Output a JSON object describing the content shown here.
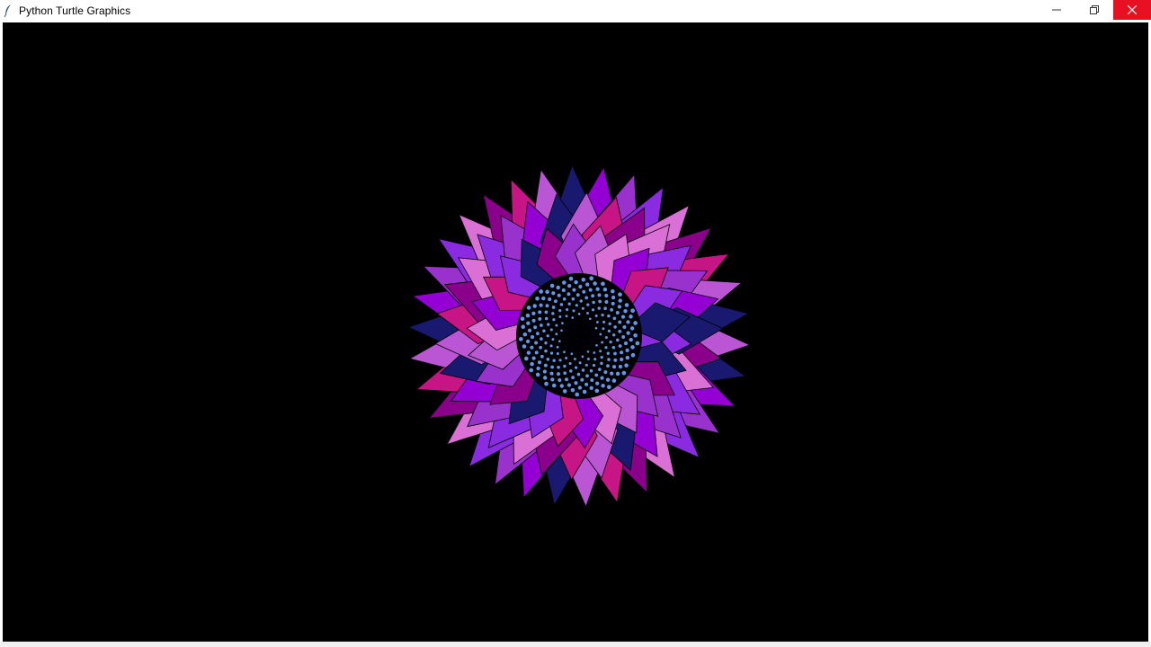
{
  "window": {
    "title": "Python Turtle Graphics",
    "controls": {
      "minimize": "minimize-icon",
      "restore": "restore-icon",
      "close": "close-icon"
    }
  },
  "canvas": {
    "background": "#000000",
    "drawing": {
      "description_icon": "flower",
      "petal_colors": [
        "#ba55d3",
        "#9932cc",
        "#8b008b",
        "#191970",
        "#8a2be2",
        "#c71585",
        "#9400d3",
        "#da70d6"
      ],
      "seed_color": "#6495ed",
      "center_color": "#000033"
    }
  }
}
